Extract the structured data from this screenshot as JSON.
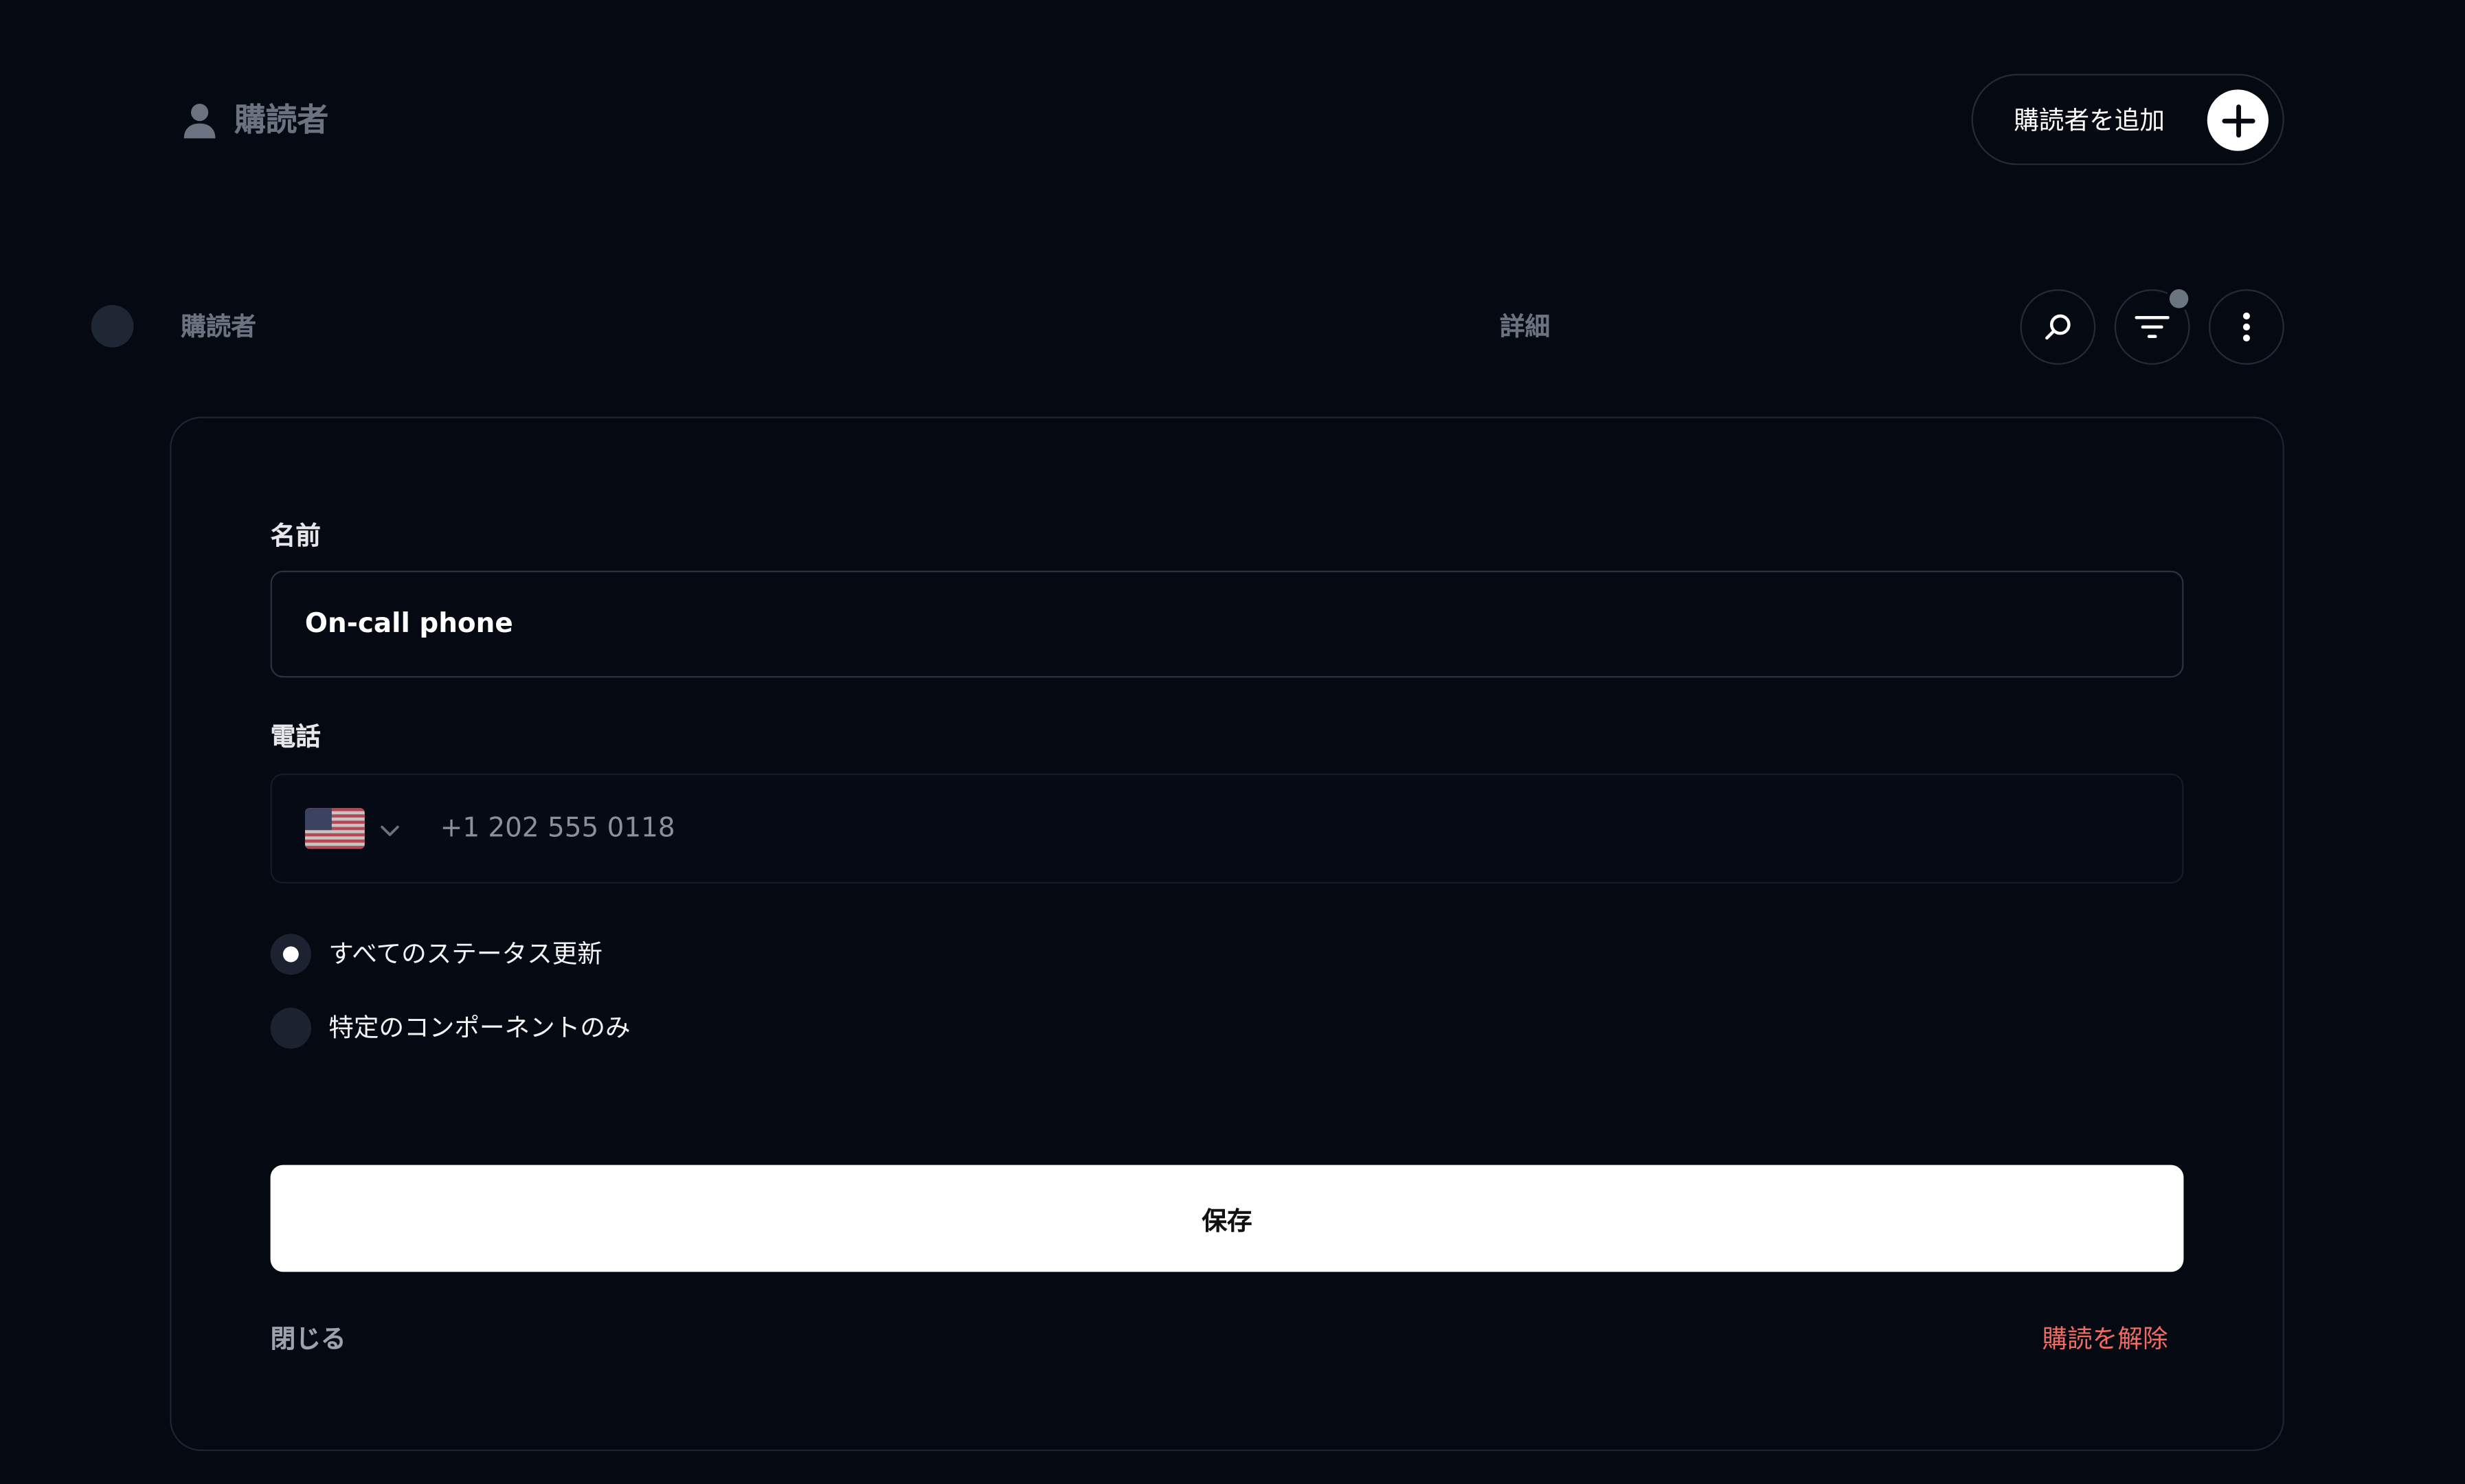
{
  "header": {
    "title": "購読者",
    "title_icon": "user-icon",
    "add_button_label": "購読者を追加",
    "add_button_icon": "plus-icon"
  },
  "table_header": {
    "col_subscriber": "購読者",
    "col_details": "詳細",
    "actions": [
      "search-icon",
      "filter-icon",
      "more-vertical-icon"
    ]
  },
  "form": {
    "name_label": "名前",
    "name_value": "On-call phone",
    "phone_label": "電話",
    "phone_country_icon": "us-flag-icon",
    "phone_value": "+1 202 555 0118",
    "radio_options": [
      {
        "label": "すべてのステータス更新",
        "selected": true
      },
      {
        "label": "特定のコンポーネントのみ",
        "selected": false
      }
    ],
    "save_label": "保存",
    "close_label": "閉じる",
    "unsubscribe_label": "購読を解除"
  },
  "colors": {
    "background": "#050912",
    "muted_text": "#6b7280",
    "danger": "#ef6b63",
    "primary_button": "#ffffff"
  }
}
